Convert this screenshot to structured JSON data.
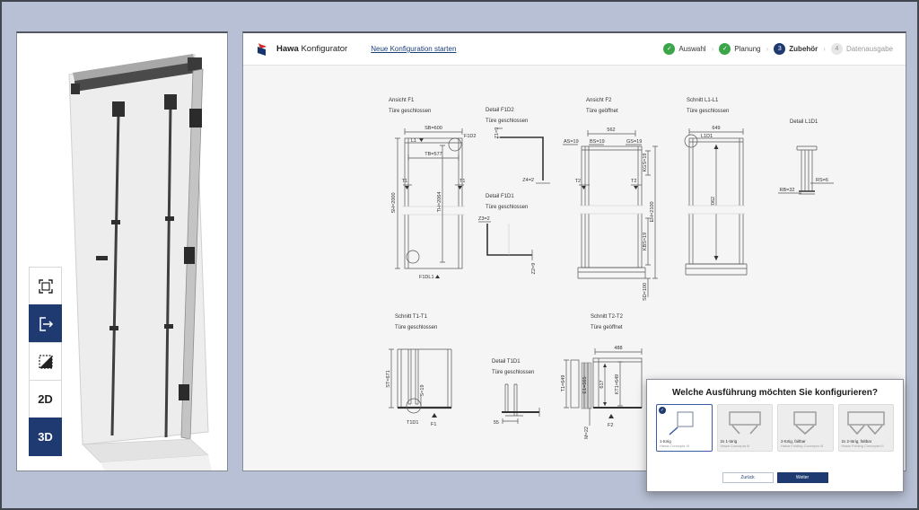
{
  "header": {
    "brand_bold": "Hawa",
    "brand_rest": " Konfigurator",
    "new_config_link": "Neue Konfiguration starten"
  },
  "stepper": {
    "check_glyph": "✓",
    "separator": "›",
    "items": [
      {
        "label": "Auswahl",
        "state": "done"
      },
      {
        "label": "Planung",
        "state": "done"
      },
      {
        "label": "Zubehör",
        "state": "active",
        "number": "3"
      },
      {
        "label": "Datenausgabe",
        "state": "pending",
        "number": "4"
      }
    ]
  },
  "viewer": {
    "tool_2d": "2D",
    "tool_3d": "3D"
  },
  "drawings": {
    "f1": {
      "title": "Ansicht F1",
      "subtitle": "Türe geschlossen",
      "sb": "SB=600",
      "l1": "L1",
      "f1d2": "F1D2",
      "tb": "TB=577",
      "t1l": "T1",
      "t1r": "T1",
      "sh": "SH=2000",
      "th": "TH=2064",
      "f1d1": "F1D1",
      "f1dl1": "F1DL1"
    },
    "df1d2": {
      "title": "Detail F1D2",
      "subtitle": "Türe geschlossen",
      "z1": "Z1=9",
      "z4": "Z4=2"
    },
    "df1d1": {
      "title": "Detail F1D1",
      "subtitle": "Türe geschlossen",
      "z3": "Z3=2",
      "z2": "Z2=9"
    },
    "f2": {
      "title": "Ansicht F2",
      "subtitle": "Türe geöffnet",
      "w562": "562",
      "as": "AS=19",
      "bs": "BS=19",
      "gs": "GS=19",
      "kgs": "KGS=19",
      "t2l": "T2",
      "t2r": "T2",
      "kbs": "KBS=19",
      "eh": "EH=2100",
      "sd": "SD=100"
    },
    "l1": {
      "title": "Schnitt L1-L1",
      "subtitle": "Türe geschlossen",
      "w649": "649",
      "l1d1": "L1D1",
      "h2062": "2062"
    },
    "dl1d1": {
      "title": "Detail L1D1",
      "rs": "RS=6",
      "rb": "RB=32"
    },
    "t1": {
      "title": "Schnitt T1-T1",
      "subtitle": "Türe geschlossen",
      "st": "ST=671",
      "s19": "S=19",
      "t1d1": "T1D1",
      "f1": "F1"
    },
    "dt1d1": {
      "title": "Detail T1D1",
      "subtitle": "Türe geschlossen",
      "w55": "55"
    },
    "t2": {
      "title": "Schnitt T2-T2",
      "subtitle": "Türe geöffnet",
      "w488": "488",
      "t1": "T1=649",
      "e1": "E1=565",
      "d617": "617",
      "kt1": "KT1=649",
      "m22": "M=22",
      "f2": "F2"
    }
  },
  "dialog": {
    "title": "Welche Ausführung möchten Sie konfigurieren?",
    "check_glyph": "✓",
    "options": [
      {
        "label": "1-türig",
        "sub": "Hawa Concepta III",
        "selected": true
      },
      {
        "label": "2x 1-türig",
        "sub": "Hawa Concepta III",
        "selected": false
      },
      {
        "label": "2-türig, faltbar",
        "sub": "Hawa Folding Concepta III",
        "selected": false
      },
      {
        "label": "2x 2-türig, faltbar",
        "sub": "Hawa Folding Concepta III",
        "selected": false
      }
    ],
    "back_label": "Zurück",
    "next_label": "Weiter"
  },
  "colors": {
    "accent_navy": "#1e3a70",
    "success_green": "#3aa549",
    "logo_red": "#cf2a27",
    "page_background": "#b7c0d4",
    "canvas_background": "#f5f5f5"
  }
}
